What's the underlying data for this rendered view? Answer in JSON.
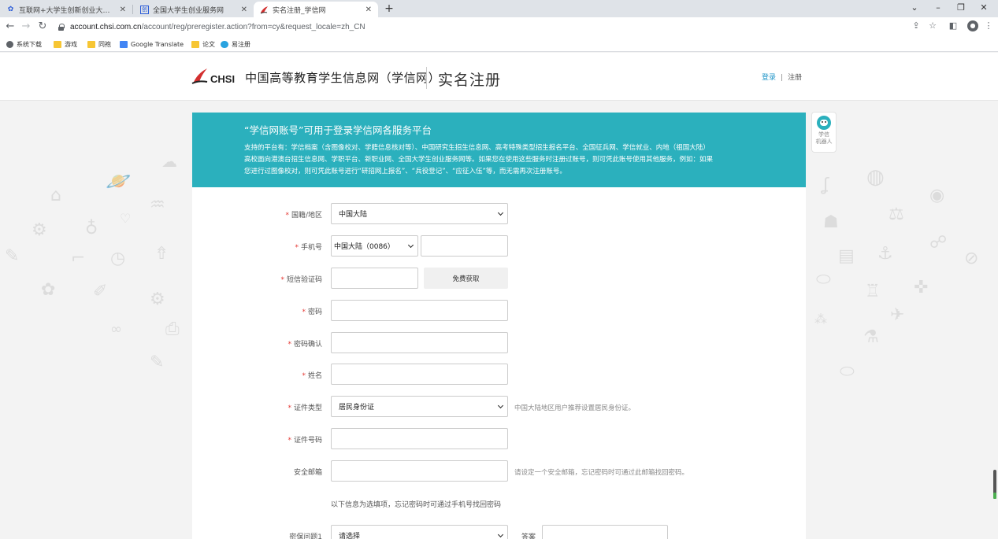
{
  "browser": {
    "tabs": [
      {
        "title": "互联网+大学生创新创业大赛_百...",
        "active": false
      },
      {
        "title": "全国大学生创业服务网",
        "active": false
      },
      {
        "title": "实名注册_学信网",
        "active": true
      }
    ],
    "url_host": "account.chsi.com.cn",
    "url_path": "/account/reg/preregister.action?from=cy&request_locale=zh_CN",
    "bookmarks": [
      "系统下载",
      "游戏",
      "同袍",
      "Google Translate",
      "论文",
      "易注册"
    ]
  },
  "header": {
    "logo_text": "CHSI",
    "site_name": "中国高等教育学生信息网（学信网）",
    "page_title": "实名注册",
    "login_link": "登录",
    "separator": "|",
    "register_link": "注册"
  },
  "robot": {
    "label_line1": "学信",
    "label_line2": "机器人"
  },
  "banner": {
    "title": "“学信网账号”可用于登录学信网各服务平台",
    "line1": "支持的平台有：学信档案（含图像校对、学籍信息核对等）、中国研究生招生信息网、高考特殊类型招生报名平台、全国征兵网、学信就业、内地（祖国大陆）",
    "line2": "高校面向港澳台招生信息网、学职平台、新职业网、全国大学生创业服务网等。如果您在使用这些服务时注册过账号，则可凭此账号使用其他服务，例如：如果",
    "line3": "您进行过图像校对，则可凭此账号进行“研招网上报名”、“兵役登记”、“应征入伍”等，而无需再次注册账号。"
  },
  "form": {
    "required_mark": "*",
    "nationality_label": "国籍/地区",
    "nationality_value": "中国大陆",
    "phone_label": "手机号",
    "phone_code_value": "中国大陆（0086）",
    "phone_value": "",
    "sms_label": "短信验证码",
    "sms_value": "",
    "sms_button": "免费获取",
    "password_label": "密码",
    "password_confirm_label": "密码确认",
    "name_label": "姓名",
    "id_type_label": "证件类型",
    "id_type_value": "居民身份证",
    "id_type_hint": "中国大陆地区用户推荐设置居民身份证。",
    "id_number_label": "证件号码",
    "email_label": "安全邮箱",
    "email_hint": "请设定一个安全邮箱，忘记密码时可通过此邮箱找回密码。",
    "optional_note": "以下信息为选填项，忘记密码时可通过手机号找回密码",
    "security_q1_label": "密保问题1",
    "security_q1_value": "请选择",
    "answer_label": "答案"
  },
  "colors": {
    "banner": "#2bb0bd",
    "required": "#e53935",
    "link": "#2196c8"
  }
}
